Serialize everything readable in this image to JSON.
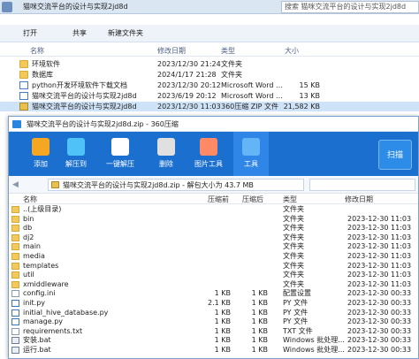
{
  "explorer": {
    "path_text": "猫咪交流平台的设计与实现2jd8d",
    "search_placeholder": "搜索 猫咪交流平台的设计与实现2jd8d",
    "toolbar": {
      "open": "打开",
      "share": "共享",
      "new_folder": "新建文件夹"
    },
    "columns": {
      "name": "名称",
      "modified": "修改日期",
      "type": "类型",
      "size": "大小"
    },
    "rows": [
      {
        "name": "环境软件",
        "modified": "2023/12/30 21:24",
        "type": "文件夹",
        "size": ""
      },
      {
        "name": "数据库",
        "modified": "2024/1/17 21:28",
        "type": "文件夹",
        "size": ""
      },
      {
        "name": "python开发环境软件下载文档",
        "modified": "2023/12/30 20:12",
        "type": "Microsoft Word ...",
        "size": "15 KB"
      },
      {
        "name": "猫咪交流平台的设计与实现2jd8d",
        "modified": "2023/6/19 20:12",
        "type": "Microsoft Word ...",
        "size": "13 KB"
      },
      {
        "name": "猫咪交流平台的设计与实现2jd8d",
        "modified": "2023/12/30 11:03",
        "type": "360压缩 ZIP 文件",
        "size": "21,582 KB"
      }
    ]
  },
  "zip": {
    "title": "猫咪交流平台的设计与实现2jd8d.zip - 360压缩",
    "tools": [
      {
        "name": "add",
        "label": "添加",
        "color": "#f5a623",
        "icon": "add-icon"
      },
      {
        "name": "extract-to",
        "label": "解压到",
        "color": "#4fc3f7",
        "icon": "extract-icon"
      },
      {
        "name": "one-click-extract",
        "label": "一键解压",
        "color": "#ffffff",
        "icon": "one-click-icon"
      },
      {
        "name": "delete",
        "label": "删除",
        "color": "#e0e0e0",
        "icon": "delete-icon"
      },
      {
        "name": "image-tool",
        "label": "图片工具",
        "color": "#ff8a65",
        "icon": "image-icon"
      },
      {
        "name": "tools",
        "label": "工具",
        "color": "#64b5f6",
        "icon": "tools-icon"
      }
    ],
    "scan_label": "扫描",
    "address": "猫咪交流平台的设计与实现2jd8d.zip - 解包大小为 43.7 MB",
    "columns": {
      "name": "名称",
      "compressed": "压缩前",
      "compressed_after": "压缩后",
      "type": "类型",
      "modified": "修改日期"
    },
    "rows": [
      {
        "name": "..(上级目录)",
        "before": "",
        "after": "",
        "type": "文件夹",
        "modified": "",
        "kind": "folder"
      },
      {
        "name": "bin",
        "before": "",
        "after": "",
        "type": "文件夹",
        "modified": "2023-12-30 11:03",
        "kind": "folder"
      },
      {
        "name": "db",
        "before": "",
        "after": "",
        "type": "文件夹",
        "modified": "2023-12-30 11:03",
        "kind": "folder"
      },
      {
        "name": "dj2",
        "before": "",
        "after": "",
        "type": "文件夹",
        "modified": "2023-12-30 11:03",
        "kind": "folder"
      },
      {
        "name": "main",
        "before": "",
        "after": "",
        "type": "文件夹",
        "modified": "2023-12-30 11:03",
        "kind": "folder"
      },
      {
        "name": "media",
        "before": "",
        "after": "",
        "type": "文件夹",
        "modified": "2023-12-30 11:03",
        "kind": "folder"
      },
      {
        "name": "templates",
        "before": "",
        "after": "",
        "type": "文件夹",
        "modified": "2023-12-30 11:03",
        "kind": "folder"
      },
      {
        "name": "util",
        "before": "",
        "after": "",
        "type": "文件夹",
        "modified": "2023-12-30 11:03",
        "kind": "folder"
      },
      {
        "name": "xmiddleware",
        "before": "",
        "after": "",
        "type": "文件夹",
        "modified": "2023-12-30 11:03",
        "kind": "folder"
      },
      {
        "name": "config.ini",
        "before": "1 KB",
        "after": "1 KB",
        "type": "配置设置",
        "modified": "2023-12-30 00:33",
        "kind": "file"
      },
      {
        "name": "init.py",
        "before": "2.1 KB",
        "after": "1 KB",
        "type": "PY 文件",
        "modified": "2023-12-30 00:33",
        "kind": "py"
      },
      {
        "name": "initial_hive_database.py",
        "before": "1 KB",
        "after": "1 KB",
        "type": "PY 文件",
        "modified": "2023-12-30 00:33",
        "kind": "py"
      },
      {
        "name": "manage.py",
        "before": "1 KB",
        "after": "1 KB",
        "type": "PY 文件",
        "modified": "2023-12-30 00:33",
        "kind": "py"
      },
      {
        "name": "requirements.txt",
        "before": "1 KB",
        "after": "1 KB",
        "type": "TXT 文件",
        "modified": "2023-12-30 00:33",
        "kind": "file"
      },
      {
        "name": "安装.bat",
        "before": "1 KB",
        "after": "1 KB",
        "type": "Windows 批处理...",
        "modified": "2023-12-30 00:33",
        "kind": "bat"
      },
      {
        "name": "运行.bat",
        "before": "1 KB",
        "after": "1 KB",
        "type": "Windows 批处理...",
        "modified": "2023-12-30 00:33",
        "kind": "bat"
      }
    ]
  }
}
